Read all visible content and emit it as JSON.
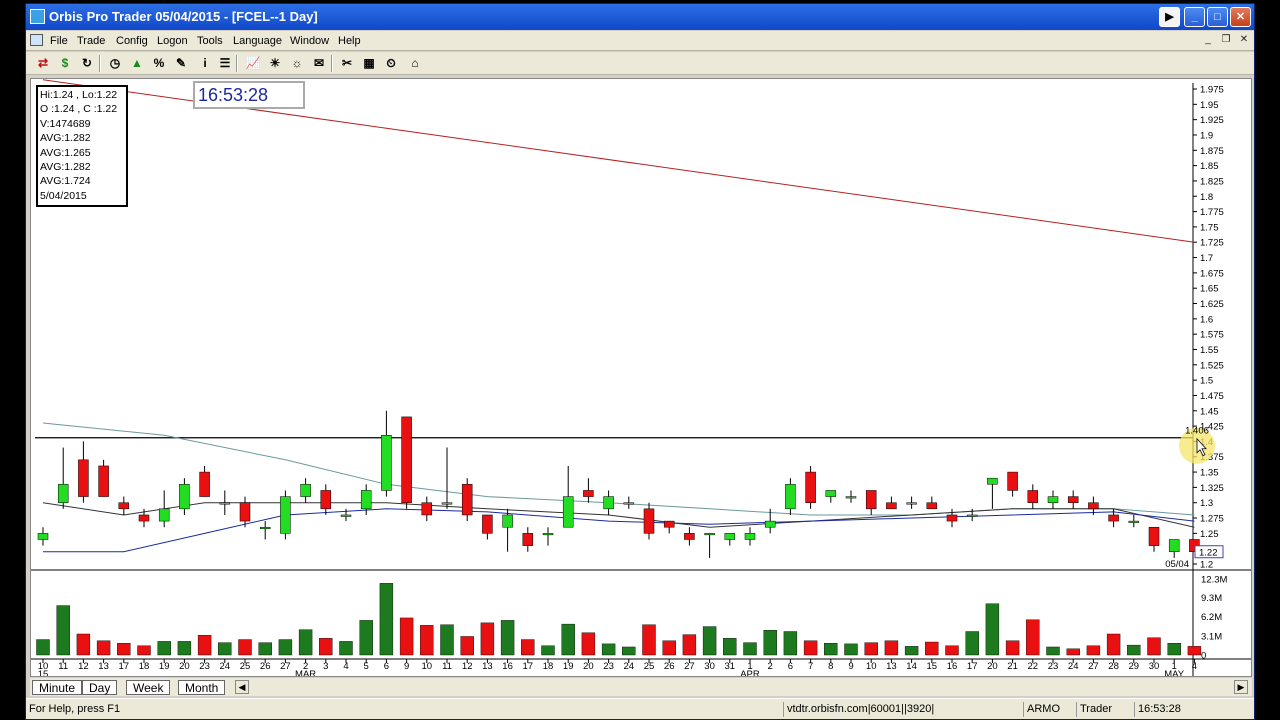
{
  "window": {
    "title": "Orbis Pro Trader  05/04/2015 - [FCEL--1 Day]"
  },
  "menu": [
    "File",
    "Trade",
    "Config",
    "Logon",
    "Tools",
    "Language",
    "Window",
    "Help"
  ],
  "toolbar": {
    "icons": [
      "exchange-icon",
      "dollar-icon",
      "refresh-icon",
      "clock-icon",
      "up-down-icon",
      "percent-icon",
      "pen-icon",
      "info-icon",
      "list-icon",
      "chart-icon",
      "alert-icon",
      "news-icon",
      "mail-icon",
      "tools-icon",
      "settings-icon",
      "timer-icon",
      "home-icon"
    ],
    "glyphs": [
      "⇄",
      "$",
      "↻",
      "◷",
      "▲",
      "%",
      "✎",
      "i",
      "☰",
      "📈",
      "☀",
      "☼",
      "✉",
      "✂",
      "▦",
      "⏲",
      "⌂"
    ]
  },
  "info": {
    "hi_lo": "Hi:1.24 , Lo:1.22",
    "open_close": "O :1.24 , C :1.22",
    "volume": "V:1474689",
    "avg1": "AVG:1.282",
    "avg2": "AVG:1.265",
    "avg3": "AVG:1.282",
    "avg4": "AVG:1.724",
    "date": "5/04/2015"
  },
  "clock": "16:53:28",
  "cursor_price": "1.406",
  "last_price": "1.22",
  "last_date": "05/04",
  "price_axis": [
    "1.975",
    "1.95",
    "1.925",
    "1.9",
    "1.875",
    "1.85",
    "1.825",
    "1.8",
    "1.775",
    "1.75",
    "1.725",
    "1.7",
    "1.675",
    "1.65",
    "1.625",
    "1.6",
    "1.575",
    "1.55",
    "1.525",
    "1.5",
    "1.475",
    "1.45",
    "1.425",
    "1.4",
    "1.375",
    "1.35",
    "1.325",
    "1.3",
    "1.275",
    "1.25",
    "1.225",
    "1.2"
  ],
  "volume_axis": [
    "12.3M",
    "9.3M",
    "6.2M",
    "3.1M",
    "0"
  ],
  "date_axis": [
    "10",
    "11",
    "12",
    "13",
    "17",
    "18",
    "19",
    "20",
    "23",
    "24",
    "25",
    "26",
    "27",
    "2",
    "3",
    "4",
    "5",
    "6",
    "9",
    "10",
    "11",
    "12",
    "13",
    "16",
    "17",
    "18",
    "19",
    "20",
    "23",
    "24",
    "25",
    "26",
    "27",
    "30",
    "31",
    "1",
    "2",
    "6",
    "7",
    "8",
    "9",
    "10",
    "13",
    "14",
    "15",
    "16",
    "17",
    "20",
    "21",
    "22",
    "23",
    "24",
    "27",
    "28",
    "29",
    "30",
    "1",
    "4"
  ],
  "month_labels": {
    "feb": "15",
    "mar": "MAR",
    "apr": "APR",
    "may": "MAY"
  },
  "tabs": [
    "Minute",
    "Day",
    "Week",
    "Month"
  ],
  "selected_tab": "Day",
  "status": {
    "help": "For Help, press F1",
    "server": "vtdtr.orbisfn.com|60001||3920|",
    "account": "ARMO",
    "role": "Trader",
    "time": "16:53:28"
  },
  "colors": {
    "up": "#22dd22",
    "down": "#e81010",
    "vol_up": "#1e7a1e",
    "vol_down": "#e81010",
    "avg_long": "#b52020",
    "avg_short": "#1a2aa0",
    "avg_mid": "#2a7a7a"
  },
  "chart_data": {
    "type": "candlestick",
    "ylim": [
      1.2,
      1.975
    ],
    "hline": 1.406,
    "candles": [
      {
        "o": 1.24,
        "h": 1.26,
        "l": 1.23,
        "c": 1.25
      },
      {
        "o": 1.3,
        "h": 1.39,
        "l": 1.29,
        "c": 1.33
      },
      {
        "o": 1.37,
        "h": 1.4,
        "l": 1.3,
        "c": 1.31
      },
      {
        "o": 1.36,
        "h": 1.37,
        "l": 1.31,
        "c": 1.31
      },
      {
        "o": 1.3,
        "h": 1.31,
        "l": 1.28,
        "c": 1.29
      },
      {
        "o": 1.28,
        "h": 1.29,
        "l": 1.26,
        "c": 1.27
      },
      {
        "o": 1.27,
        "h": 1.32,
        "l": 1.26,
        "c": 1.29
      },
      {
        "o": 1.29,
        "h": 1.34,
        "l": 1.28,
        "c": 1.33
      },
      {
        "o": 1.35,
        "h": 1.36,
        "l": 1.31,
        "c": 1.31
      },
      {
        "o": 1.3,
        "h": 1.32,
        "l": 1.28,
        "c": 1.3
      },
      {
        "o": 1.3,
        "h": 1.31,
        "l": 1.26,
        "c": 1.27
      },
      {
        "o": 1.26,
        "h": 1.27,
        "l": 1.24,
        "c": 1.26
      },
      {
        "o": 1.25,
        "h": 1.32,
        "l": 1.24,
        "c": 1.31
      },
      {
        "o": 1.31,
        "h": 1.34,
        "l": 1.3,
        "c": 1.33
      },
      {
        "o": 1.32,
        "h": 1.33,
        "l": 1.28,
        "c": 1.29
      },
      {
        "o": 1.28,
        "h": 1.29,
        "l": 1.27,
        "c": 1.28
      },
      {
        "o": 1.29,
        "h": 1.33,
        "l": 1.28,
        "c": 1.32
      },
      {
        "o": 1.32,
        "h": 1.45,
        "l": 1.31,
        "c": 1.41
      },
      {
        "o": 1.44,
        "h": 1.44,
        "l": 1.29,
        "c": 1.3
      },
      {
        "o": 1.3,
        "h": 1.31,
        "l": 1.27,
        "c": 1.28
      },
      {
        "o": 1.3,
        "h": 1.39,
        "l": 1.29,
        "c": 1.3
      },
      {
        "o": 1.33,
        "h": 1.34,
        "l": 1.27,
        "c": 1.28
      },
      {
        "o": 1.28,
        "h": 1.28,
        "l": 1.24,
        "c": 1.25
      },
      {
        "o": 1.26,
        "h": 1.29,
        "l": 1.22,
        "c": 1.28
      },
      {
        "o": 1.25,
        "h": 1.26,
        "l": 1.22,
        "c": 1.23
      },
      {
        "o": 1.25,
        "h": 1.26,
        "l": 1.23,
        "c": 1.25
      },
      {
        "o": 1.26,
        "h": 1.36,
        "l": 1.26,
        "c": 1.31
      },
      {
        "o": 1.32,
        "h": 1.34,
        "l": 1.3,
        "c": 1.31
      },
      {
        "o": 1.29,
        "h": 1.32,
        "l": 1.28,
        "c": 1.31
      },
      {
        "o": 1.3,
        "h": 1.31,
        "l": 1.29,
        "c": 1.3
      },
      {
        "o": 1.29,
        "h": 1.3,
        "l": 1.24,
        "c": 1.25
      },
      {
        "o": 1.27,
        "h": 1.27,
        "l": 1.25,
        "c": 1.26
      },
      {
        "o": 1.25,
        "h": 1.26,
        "l": 1.23,
        "c": 1.24
      },
      {
        "o": 1.25,
        "h": 1.25,
        "l": 1.21,
        "c": 1.25
      },
      {
        "o": 1.24,
        "h": 1.25,
        "l": 1.23,
        "c": 1.25
      },
      {
        "o": 1.24,
        "h": 1.26,
        "l": 1.23,
        "c": 1.25
      },
      {
        "o": 1.26,
        "h": 1.29,
        "l": 1.25,
        "c": 1.27
      },
      {
        "o": 1.29,
        "h": 1.34,
        "l": 1.28,
        "c": 1.33
      },
      {
        "o": 1.35,
        "h": 1.36,
        "l": 1.29,
        "c": 1.3
      },
      {
        "o": 1.31,
        "h": 1.32,
        "l": 1.3,
        "c": 1.32
      },
      {
        "o": 1.31,
        "h": 1.32,
        "l": 1.3,
        "c": 1.31
      },
      {
        "o": 1.32,
        "h": 1.32,
        "l": 1.28,
        "c": 1.29
      },
      {
        "o": 1.3,
        "h": 1.31,
        "l": 1.29,
        "c": 1.29
      },
      {
        "o": 1.3,
        "h": 1.31,
        "l": 1.29,
        "c": 1.3
      },
      {
        "o": 1.3,
        "h": 1.31,
        "l": 1.29,
        "c": 1.29
      },
      {
        "o": 1.28,
        "h": 1.29,
        "l": 1.26,
        "c": 1.27
      },
      {
        "o": 1.28,
        "h": 1.29,
        "l": 1.27,
        "c": 1.28
      },
      {
        "o": 1.33,
        "h": 1.34,
        "l": 1.29,
        "c": 1.34
      },
      {
        "o": 1.35,
        "h": 1.35,
        "l": 1.31,
        "c": 1.32
      },
      {
        "o": 1.32,
        "h": 1.33,
        "l": 1.29,
        "c": 1.3
      },
      {
        "o": 1.3,
        "h": 1.32,
        "l": 1.29,
        "c": 1.31
      },
      {
        "o": 1.31,
        "h": 1.32,
        "l": 1.29,
        "c": 1.3
      },
      {
        "o": 1.3,
        "h": 1.31,
        "l": 1.28,
        "c": 1.29
      },
      {
        "o": 1.28,
        "h": 1.29,
        "l": 1.26,
        "c": 1.27
      },
      {
        "o": 1.27,
        "h": 1.28,
        "l": 1.26,
        "c": 1.27
      },
      {
        "o": 1.26,
        "h": 1.26,
        "l": 1.22,
        "c": 1.23
      },
      {
        "o": 1.22,
        "h": 1.24,
        "l": 1.21,
        "c": 1.24
      },
      {
        "o": 1.24,
        "h": 1.24,
        "l": 1.22,
        "c": 1.22
      }
    ],
    "volume_millions": [
      2.5,
      8.0,
      3.4,
      2.3,
      1.9,
      1.5,
      2.2,
      2.2,
      3.2,
      2.0,
      2.5,
      2.0,
      2.5,
      4.1,
      2.7,
      2.2,
      5.6,
      11.6,
      6.0,
      4.8,
      4.9,
      3.0,
      5.2,
      5.6,
      2.5,
      1.5,
      5.0,
      3.6,
      1.8,
      1.3,
      4.9,
      2.3,
      3.3,
      4.6,
      2.7,
      2.0,
      4.0,
      3.8,
      2.3,
      1.9,
      1.8,
      2.0,
      2.3,
      1.4,
      2.1,
      1.5,
      3.8,
      8.3,
      2.3,
      5.7,
      1.3,
      1.0,
      1.5,
      3.4,
      1.6,
      2.8,
      1.9,
      1.4
    ],
    "avg_long": [
      [
        0,
        1.99
      ],
      [
        57,
        1.725
      ]
    ],
    "avg_short": [
      [
        0,
        1.22
      ],
      [
        4,
        1.22
      ],
      [
        8,
        1.25
      ],
      [
        12,
        1.28
      ],
      [
        17,
        1.29
      ],
      [
        22,
        1.285
      ],
      [
        28,
        1.27
      ],
      [
        33,
        1.265
      ],
      [
        38,
        1.27
      ],
      [
        43,
        1.275
      ],
      [
        48,
        1.28
      ],
      [
        53,
        1.285
      ],
      [
        57,
        1.27
      ]
    ],
    "avg_mid": [
      [
        0,
        1.3
      ],
      [
        4,
        1.28
      ],
      [
        8,
        1.3
      ],
      [
        12,
        1.3
      ],
      [
        17,
        1.3
      ],
      [
        22,
        1.29
      ],
      [
        28,
        1.28
      ],
      [
        33,
        1.26
      ],
      [
        38,
        1.27
      ],
      [
        43,
        1.28
      ],
      [
        48,
        1.29
      ],
      [
        53,
        1.29
      ],
      [
        57,
        1.26
      ]
    ],
    "avg_slow": [
      [
        0,
        1.43
      ],
      [
        6,
        1.41
      ],
      [
        12,
        1.37
      ],
      [
        17,
        1.33
      ],
      [
        22,
        1.31
      ],
      [
        28,
        1.3
      ],
      [
        33,
        1.29
      ],
      [
        38,
        1.28
      ],
      [
        43,
        1.28
      ],
      [
        48,
        1.29
      ],
      [
        53,
        1.29
      ],
      [
        57,
        1.28
      ]
    ]
  }
}
